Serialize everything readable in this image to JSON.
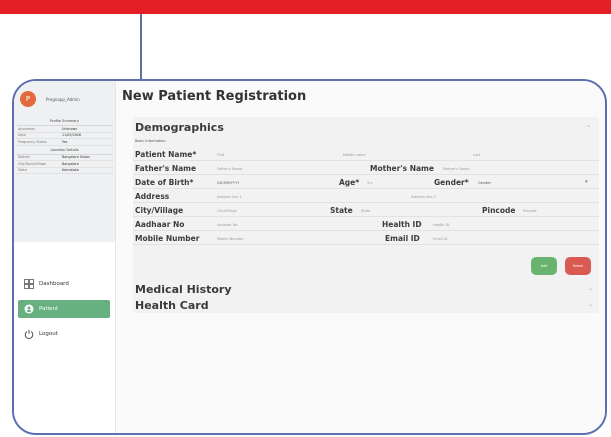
{
  "profile": {
    "avatar_initial": "P",
    "name": "Pregnapp_Admin"
  },
  "summary": {
    "title": "Profile Summary",
    "rows": [
      {
        "k": "Ayushman",
        "v": "Unknown"
      },
      {
        "k": "Date",
        "v": "11/03/2026"
      },
      {
        "k": "Pregnancy Status",
        "v": "Yes"
      }
    ]
  },
  "location": {
    "title": "Location Details",
    "rows": [
      {
        "k": "District",
        "v": "Bangalore Urban"
      },
      {
        "k": "City/Town/Village",
        "v": "Bangalore"
      },
      {
        "k": "State",
        "v": "Karnataka"
      }
    ]
  },
  "nav": [
    {
      "label": "Dashboard",
      "icon": "grid-icon"
    },
    {
      "label": "Patient",
      "icon": "patient-icon"
    },
    {
      "label": "Logout",
      "icon": "power-icon"
    }
  ],
  "page": {
    "title": "New Patient Registration"
  },
  "demographics": {
    "title": "Demographics",
    "subtitle": "Basic Information",
    "patient_name_label": "Patient Name*",
    "ph_first": "First",
    "ph_middle": "Middle name",
    "ph_last": "Last",
    "fathers_name_label": "Father's Name",
    "ph_fathers": "Father's Name",
    "mothers_name_label": "Mother's Name",
    "ph_mothers": "Mother's Name",
    "dob_label": "Date of Birth*",
    "dob_value": "DD/MM/YYYY",
    "age_label": "Age*",
    "age_value": "Yrs",
    "gender_label": "Gender*",
    "gender_value": "Gender",
    "address_label": "Address",
    "ph_address1": "Address line 1",
    "ph_address2": "Address line 2",
    "city_label": "City/Village",
    "ph_city": "City/Village",
    "state_label": "State",
    "ph_state": "State",
    "pincode_label": "Pincode",
    "ph_pincode": "Pincode",
    "aadhaar_label": "Aadhaar No",
    "ph_aadhaar": "Aadhaar No",
    "health_label": "Health ID",
    "ph_health": "Health ID",
    "mobile_label": "Mobile Number",
    "ph_mobile": "Mobile Number",
    "email_label": "Email ID",
    "ph_email": "Email ID",
    "add_label": "Add",
    "reset_label": "Reset"
  },
  "sections": {
    "medical_history": "Medical History",
    "health_card": "Health Card"
  },
  "colors": {
    "accent_red": "#e31e24",
    "frame": "#5e6fb0",
    "active_nav": "#66b17f",
    "add": "#6ab36e",
    "reset": "#d85a52"
  }
}
